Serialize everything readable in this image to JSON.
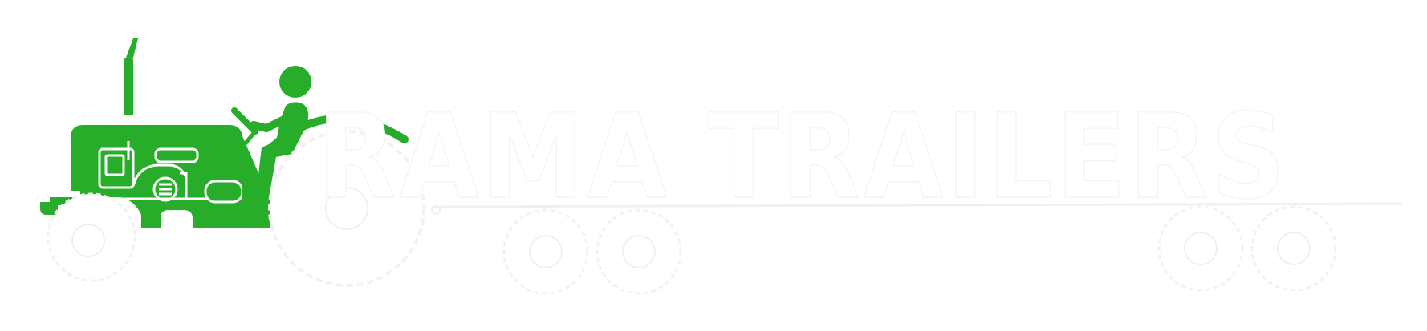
{
  "logo": {
    "brand_name": "RAMA TRAILERS",
    "colors": {
      "tractor_green": "#27ad2a",
      "wordmark_white": "#ffffff",
      "wheel_white": "#ffffff",
      "background": "#ffffff",
      "engine_detail_green": "#27ad2a"
    },
    "icons": {
      "tractor": "tractor-with-driver-icon",
      "trailer": "trailer-wheels-icon"
    }
  }
}
